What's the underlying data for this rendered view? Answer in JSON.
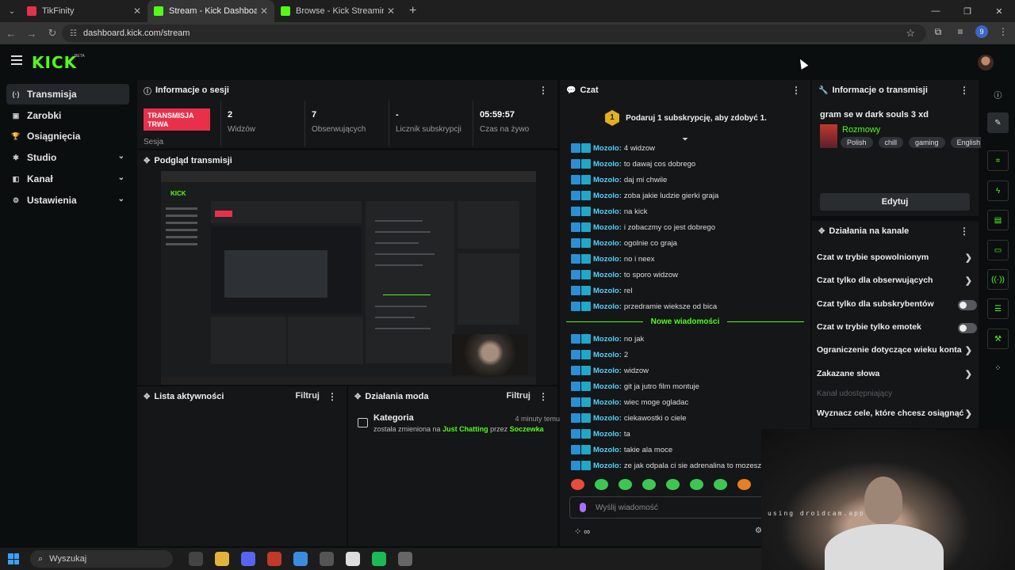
{
  "browser": {
    "tabs": [
      {
        "title": "TikFinity",
        "favicon_color": "#e8304a",
        "active": false
      },
      {
        "title": "Stream - Kick Dashboard",
        "favicon_color": "#53fc18",
        "active": true
      },
      {
        "title": "Browse - Kick Streaming",
        "favicon_color": "#53fc18",
        "active": false
      }
    ],
    "url": "dashboard.kick.com/stream",
    "profile_badge": "9"
  },
  "brand": {
    "logo": "KICK",
    "beta": "BETA",
    "accent": "#53fc18",
    "live_color": "#e8304a"
  },
  "sidebar": {
    "items": [
      {
        "label": "Transmisja",
        "icon": "broadcast-icon",
        "glyph": "(·)",
        "active": true,
        "has_chevron": false
      },
      {
        "label": "Zarobki",
        "icon": "earnings-icon",
        "glyph": "▣",
        "active": false,
        "has_chevron": false
      },
      {
        "label": "Osiągnięcia",
        "icon": "trophy-icon",
        "glyph": "🏆",
        "active": false,
        "has_chevron": false
      },
      {
        "label": "Studio",
        "icon": "studio-icon",
        "glyph": "✱",
        "active": false,
        "has_chevron": true
      },
      {
        "label": "Kanał",
        "icon": "channel-icon",
        "glyph": "◧",
        "active": false,
        "has_chevron": true
      },
      {
        "label": "Ustawienia",
        "icon": "settings-icon",
        "glyph": "⚙",
        "active": false,
        "has_chevron": true
      }
    ]
  },
  "session": {
    "title": "Informacje o sesji",
    "live_label": "TRANSMISJA TRWA",
    "session_label": "Sesja",
    "stats": [
      {
        "value": "2",
        "label": "Widzów"
      },
      {
        "value": "7",
        "label": "Obserwujących"
      },
      {
        "value": "-",
        "label": "Licznik subskrypcji"
      },
      {
        "value": "05:59:57",
        "label": "Czas na żywo"
      }
    ]
  },
  "preview": {
    "title": "Podgląd transmisji"
  },
  "activity": {
    "title": "Lista aktywności",
    "filter": "Filtruj"
  },
  "mod": {
    "title": "Działania moda",
    "filter": "Filtruj",
    "entry": {
      "title": "Kategoria",
      "time": "4 minuty temu",
      "text_pre": "została zmieniona na",
      "category": "Just Chatting",
      "text_mid": "przez",
      "user": "Soczewka"
    }
  },
  "chat": {
    "title": "Czat",
    "promo_count": "1",
    "promo": "Podaruj 1 subskrypcję, aby zdobyć 1.",
    "username": "Mozolo:",
    "messages_old": [
      "4 widzow",
      "to dawaj cos dobrego",
      "daj mi chwile",
      "zoba jakie ludzie gierki graja",
      "na kick",
      "i zobaczmy co jest dobrego",
      "ogolnie co graja",
      "no i neex",
      "to sporo widzow",
      "rel",
      "przedramie wieksze od bica"
    ],
    "new_label": "Nowe wiadomości",
    "messages_new": [
      "no jak",
      "2",
      "widzow",
      "git ja jutro film montuje",
      "wiec moge ogladac",
      "ciekawostki o ciele",
      "ta",
      "takie ala moce",
      "ze jak odpala ci sie adrenalina to mozesz duzo"
    ],
    "placeholder": "Wyślij wiadomość",
    "bottom": "∞"
  },
  "stream_info": {
    "title": "Informacje o transmisji",
    "stream_title": "gram se w dark souls 3 xd",
    "category": "Rozmowy",
    "tags": [
      "Polish",
      "chill",
      "gaming",
      "English"
    ],
    "edit": "Edytuj"
  },
  "channel_actions": {
    "title": "Działania na kanale",
    "items": [
      {
        "label": "Czat w trybie spowolnionym",
        "kind": "chevron"
      },
      {
        "label": "Czat tylko dla obserwujących",
        "kind": "chevron"
      },
      {
        "label": "Czat tylko dla subskrybentów",
        "kind": "toggle"
      },
      {
        "label": "Czat w trybie tylko emotek",
        "kind": "toggle"
      },
      {
        "label": "Ograniczenie dotyczące wieku konta",
        "kind": "chevron"
      },
      {
        "label": "Zakazane słowa",
        "kind": "chevron"
      },
      {
        "label": "Kanał udostępniający",
        "kind": "dim"
      },
      {
        "label": "Wyznacz cele, które chcesz osiągnąć",
        "kind": "chevron"
      }
    ]
  },
  "webcam": {
    "watermark": "using droidcam.app"
  },
  "taskbar": {
    "search": "Wyszukaj",
    "apps": [
      "#444",
      "#e2b33b",
      "#5865f2",
      "#c0392b",
      "#3a8dde",
      "#555",
      "#ddd",
      "#1db954",
      "#666"
    ]
  }
}
